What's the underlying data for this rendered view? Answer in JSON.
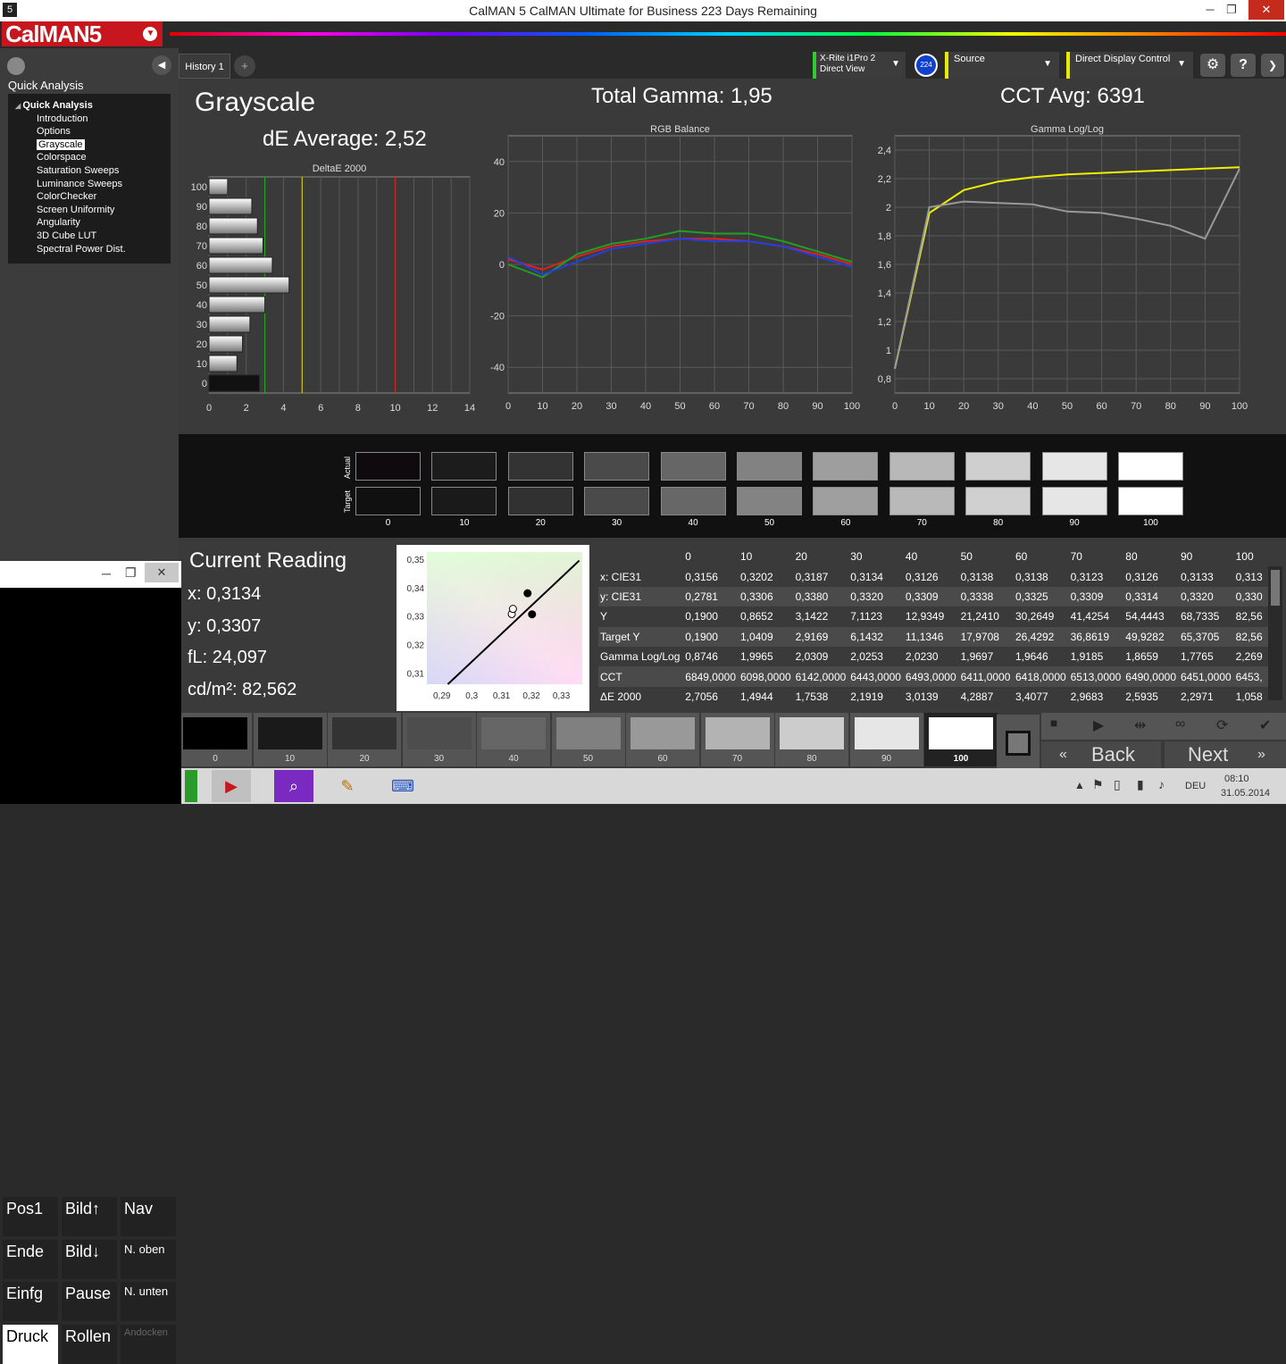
{
  "window": {
    "title": "CalMAN 5 CalMAN Ultimate for Business 223 Days Remaining",
    "minimize": "─",
    "restore": "❐",
    "close": "✕"
  },
  "logo": "CalMAN5",
  "tabs": [
    {
      "label": "History 1"
    },
    {
      "label": "+"
    }
  ],
  "devices": {
    "meter_line1": "X-Rite i1Pro 2",
    "meter_line2": "Direct View",
    "meter_badge": "224",
    "source": "Source",
    "display": "Direct Display Control"
  },
  "sidebar": {
    "header": "Quick Analysis",
    "tree_root": "Quick Analysis",
    "items": [
      "Introduction",
      "Options",
      "Grayscale",
      "Colorspace",
      "Saturation Sweeps",
      "Luminance Sweeps",
      "ColorChecker",
      "Screen Uniformity",
      "Angularity",
      "3D Cube LUT",
      "Spectral Power Dist."
    ],
    "selected": "Grayscale"
  },
  "main": {
    "title": "Grayscale",
    "de_average": "dE Average: 2,52",
    "total_gamma": "Total Gamma: 1,95",
    "cct_avg": "CCT Avg: 6391"
  },
  "chart_data": [
    {
      "type": "bar",
      "title": "DeltaE 2000",
      "orientation": "horizontal",
      "categories": [
        "100",
        "90",
        "80",
        "70",
        "60",
        "50",
        "40",
        "30",
        "20",
        "10",
        "0"
      ],
      "values": [
        1.0,
        2.3,
        2.6,
        2.9,
        3.4,
        4.3,
        3.0,
        2.2,
        1.8,
        1.5,
        2.7
      ],
      "xlim": [
        0,
        14
      ],
      "xticks": [
        "0",
        "2",
        "4",
        "6",
        "8",
        "10",
        "12",
        "14"
      ],
      "reference_lines": [
        {
          "x": 3,
          "color": "#22aa22"
        },
        {
          "x": 5,
          "color": "#dddd00"
        },
        {
          "x": 10,
          "color": "#dd2222"
        }
      ]
    },
    {
      "type": "line",
      "title": "RGB Balance",
      "x": [
        0,
        10,
        20,
        30,
        40,
        50,
        60,
        70,
        80,
        90,
        100
      ],
      "xlim": [
        0,
        100
      ],
      "ylim": [
        -50,
        50
      ],
      "yticks": [
        "40",
        "20",
        "0",
        "-20",
        "-40"
      ],
      "xticks": [
        "0",
        "10",
        "20",
        "30",
        "40",
        "50",
        "60",
        "70",
        "80",
        "90",
        "100"
      ],
      "series": [
        {
          "color": "#e02020",
          "values": [
            2,
            -2,
            3,
            7,
            9,
            10,
            10,
            9,
            7,
            4,
            0
          ]
        },
        {
          "color": "#20a020",
          "values": [
            0,
            -5,
            4,
            8,
            10,
            13,
            12,
            12,
            9,
            5,
            1
          ]
        },
        {
          "color": "#2040e0",
          "values": [
            3,
            -4,
            1,
            6,
            8,
            10,
            9,
            9,
            7,
            3,
            -1
          ]
        }
      ]
    },
    {
      "type": "line",
      "title": "Gamma Log/Log",
      "x": [
        0,
        10,
        20,
        30,
        40,
        50,
        60,
        70,
        80,
        90,
        100
      ],
      "xlim": [
        0,
        100
      ],
      "ylim": [
        0.7,
        2.5
      ],
      "yticks": [
        "2,4",
        "2,2",
        "2",
        "1,8",
        "1,6",
        "1,4",
        "1,2",
        "1",
        "0,8"
      ],
      "xticks": [
        "0",
        "10",
        "20",
        "30",
        "40",
        "50",
        "60",
        "70",
        "80",
        "90",
        "100"
      ],
      "series": [
        {
          "color": "#f0f000",
          "values": [
            0.87,
            1.96,
            2.12,
            2.18,
            2.21,
            2.23,
            2.24,
            2.25,
            2.26,
            2.27,
            2.28
          ]
        },
        {
          "color": "#999999",
          "values": [
            0.87,
            2.0,
            2.04,
            2.03,
            2.02,
            1.97,
            1.96,
            1.92,
            1.87,
            1.78,
            2.27
          ]
        }
      ]
    }
  ],
  "swatches": {
    "actual_label": "Actual",
    "target_label": "Target",
    "labels": [
      "0",
      "10",
      "20",
      "30",
      "40",
      "50",
      "60",
      "70",
      "80",
      "90",
      "100"
    ],
    "actual": [
      "#0e0a0e",
      "#1c1c1c",
      "#333333",
      "#4a4a4a",
      "#666666",
      "#828282",
      "#9e9e9e",
      "#b8b8b8",
      "#cfcfcf",
      "#e6e6e6",
      "#ffffff"
    ],
    "target": [
      "#101010",
      "#1a1a1a",
      "#313131",
      "#4a4a4a",
      "#676767",
      "#838383",
      "#9f9f9f",
      "#b9b9b9",
      "#d0d0d0",
      "#e6e6e6",
      "#ffffff"
    ]
  },
  "reading": {
    "title": "Current Reading",
    "x": "x: 0,3134",
    "y": "y: 0,3307",
    "fl": "fL: 24,097",
    "cdm2": "cd/m²: 82,562"
  },
  "cie": {
    "yticks": [
      "0,35",
      "0,34",
      "0,33",
      "0,32",
      "0,31"
    ],
    "xticks": [
      "0,29",
      "0,3",
      "0,31",
      "0,32",
      "0,33"
    ],
    "points": [
      {
        "x": 0.3134,
        "y": 0.3307
      },
      {
        "x": 0.3138,
        "y": 0.3325
      },
      {
        "x": 0.3187,
        "y": 0.338
      },
      {
        "x": 0.3202,
        "y": 0.3306
      }
    ]
  },
  "table": {
    "headers": [
      "",
      "0",
      "10",
      "20",
      "30",
      "40",
      "50",
      "60",
      "70",
      "80",
      "90",
      "100"
    ],
    "rows": [
      [
        "x: CIE31",
        "0,3156",
        "0,3202",
        "0,3187",
        "0,3134",
        "0,3126",
        "0,3138",
        "0,3138",
        "0,3123",
        "0,3126",
        "0,3133",
        "0,313"
      ],
      [
        "y: CIE31",
        "0,2781",
        "0,3306",
        "0,3380",
        "0,3320",
        "0,3309",
        "0,3338",
        "0,3325",
        "0,3309",
        "0,3314",
        "0,3320",
        "0,330"
      ],
      [
        "Y",
        "0,1900",
        "0,8652",
        "3,1422",
        "7,1123",
        "12,9349",
        "21,2410",
        "30,2649",
        "41,4254",
        "54,4443",
        "68,7335",
        "82,56"
      ],
      [
        "Target Y",
        "0,1900",
        "1,0409",
        "2,9169",
        "6,1432",
        "11,1346",
        "17,9708",
        "26,4292",
        "36,8619",
        "49,9282",
        "65,3705",
        "82,56"
      ],
      [
        "Gamma Log/Log",
        "0,8746",
        "1,9965",
        "2,0309",
        "2,0253",
        "2,0230",
        "1,9697",
        "1,9646",
        "1,9185",
        "1,8659",
        "1,7765",
        "2,269"
      ],
      [
        "CCT",
        "6849,0000",
        "6098,0000",
        "6142,0000",
        "6443,0000",
        "6493,0000",
        "6411,0000",
        "6418,0000",
        "6513,0000",
        "6490,0000",
        "6451,0000",
        "6453,"
      ],
      [
        "ΔE 2000",
        "2,7056",
        "1,4944",
        "1,7538",
        "2,1919",
        "3,0139",
        "4,2887",
        "3,4077",
        "2,9683",
        "2,5935",
        "2,2971",
        "1,058"
      ]
    ]
  },
  "patches": {
    "labels": [
      "0",
      "10",
      "20",
      "30",
      "40",
      "50",
      "60",
      "70",
      "80",
      "90",
      "100"
    ],
    "colors": [
      "#000000",
      "#1a1a1a",
      "#333333",
      "#4d4d4d",
      "#666666",
      "#808080",
      "#999999",
      "#b3b3b3",
      "#cccccc",
      "#e6e6e6",
      "#ffffff"
    ],
    "selected": "100"
  },
  "nav": {
    "back": "Back",
    "next": "Next"
  },
  "keyboard": {
    "keys": [
      "Pos1",
      "Bild↑",
      "Nav",
      "Ende",
      "Bild↓",
      "N. oben",
      "Einfg",
      "Pause",
      "N. unten",
      "Druck",
      "Rollen",
      "Andocken"
    ]
  },
  "taskbar": {
    "lang": "DEU",
    "time": "08:10",
    "date": "31.05.2014"
  }
}
